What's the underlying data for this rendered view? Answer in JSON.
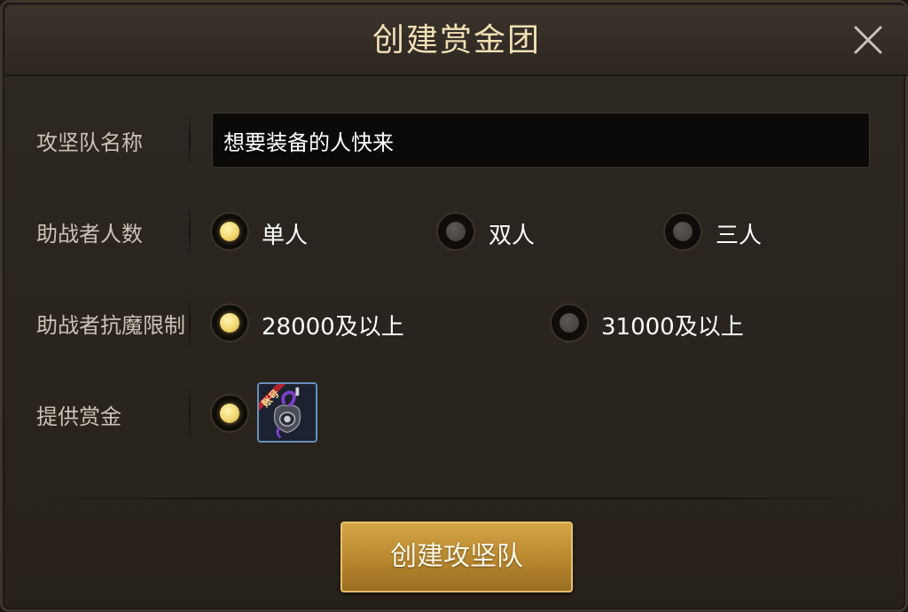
{
  "dialog": {
    "title": "创建赏金团",
    "close_icon": "close-icon"
  },
  "team_name": {
    "label": "攻坚队名称",
    "value": "想要装备的人快来"
  },
  "helper_count": {
    "label": "助战者人数",
    "options": [
      {
        "label": "单人",
        "selected": true
      },
      {
        "label": "双人",
        "selected": false
      },
      {
        "label": "三人",
        "selected": false
      }
    ]
  },
  "magic_resist": {
    "label": "助战者抗魔限制",
    "options": [
      {
        "label": "28000及以上",
        "selected": true
      },
      {
        "label": "31000及以上",
        "selected": false
      }
    ]
  },
  "bounty": {
    "label": "提供赏金",
    "selected": true,
    "item_badge": "账号",
    "item_icon": "bounty-item-icon"
  },
  "create_button": {
    "label": "创建攻坚队"
  },
  "colors": {
    "title_text": "#f1dfb4",
    "button_gold": "#c69535",
    "radio_selected": "#f2d871"
  }
}
